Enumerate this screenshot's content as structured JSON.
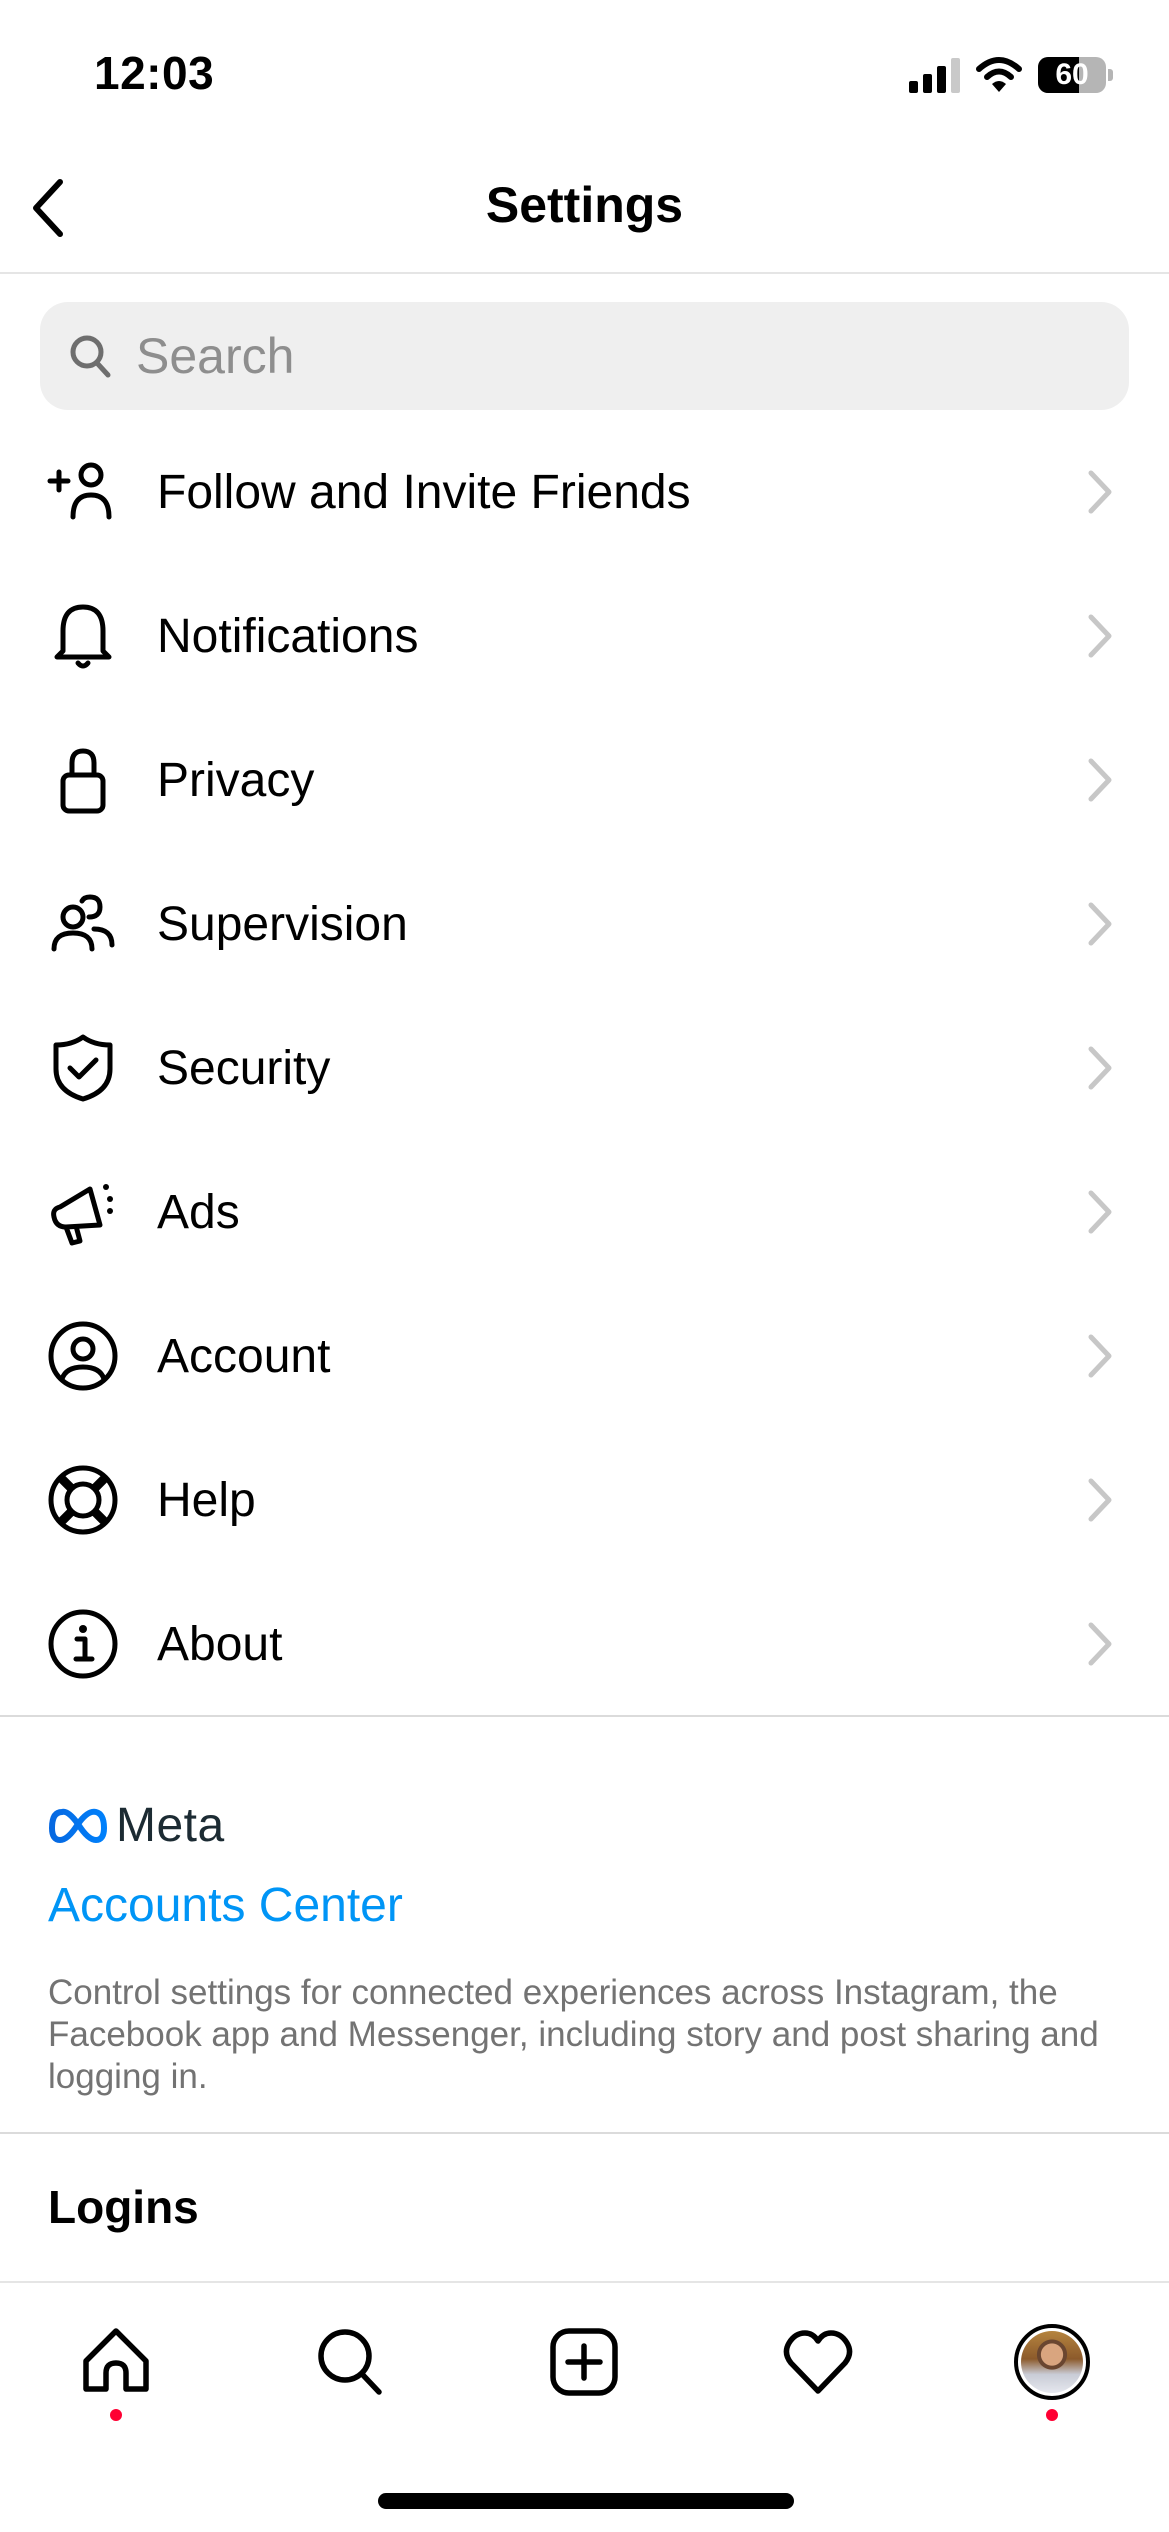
{
  "status_bar": {
    "time": "12:03",
    "signal_bars_active": 3,
    "signal_bars_total": 4,
    "wifi": "wifi-icon",
    "battery_percent": 60,
    "battery_label": "60"
  },
  "header": {
    "title": "Settings",
    "back_icon": "chevron-left-icon"
  },
  "search": {
    "placeholder": "Search",
    "value": ""
  },
  "menu": {
    "items": [
      {
        "label": "Follow and Invite Friends",
        "icon": "add-person-icon"
      },
      {
        "label": "Notifications",
        "icon": "bell-icon"
      },
      {
        "label": "Privacy",
        "icon": "lock-icon"
      },
      {
        "label": "Supervision",
        "icon": "people-icon"
      },
      {
        "label": "Security",
        "icon": "shield-check-icon"
      },
      {
        "label": "Ads",
        "icon": "megaphone-icon"
      },
      {
        "label": "Account",
        "icon": "account-circle-icon"
      },
      {
        "label": "Help",
        "icon": "lifebuoy-icon"
      },
      {
        "label": "About",
        "icon": "info-icon"
      }
    ]
  },
  "meta_section": {
    "logo_text": "Meta",
    "accounts_center_label": "Accounts Center",
    "description": "Control settings for connected experiences across Instagram, the Facebook app and Messenger, including story and post sharing and logging in."
  },
  "logins": {
    "title": "Logins"
  },
  "tab_bar": {
    "tabs": [
      {
        "name": "home",
        "icon": "home-icon",
        "has_dot": true
      },
      {
        "name": "search",
        "icon": "search-icon",
        "has_dot": false
      },
      {
        "name": "create",
        "icon": "plus-square-icon",
        "has_dot": false
      },
      {
        "name": "activity",
        "icon": "heart-icon",
        "has_dot": false
      },
      {
        "name": "profile",
        "icon": "avatar",
        "has_dot": true
      }
    ]
  },
  "colors": {
    "accent_link": "#0095f6",
    "notification_dot": "#ff0033",
    "chevron": "#c7c7c7",
    "secondary_text": "#737373",
    "search_bg": "#efefef",
    "meta_blue": "#0668e1"
  }
}
